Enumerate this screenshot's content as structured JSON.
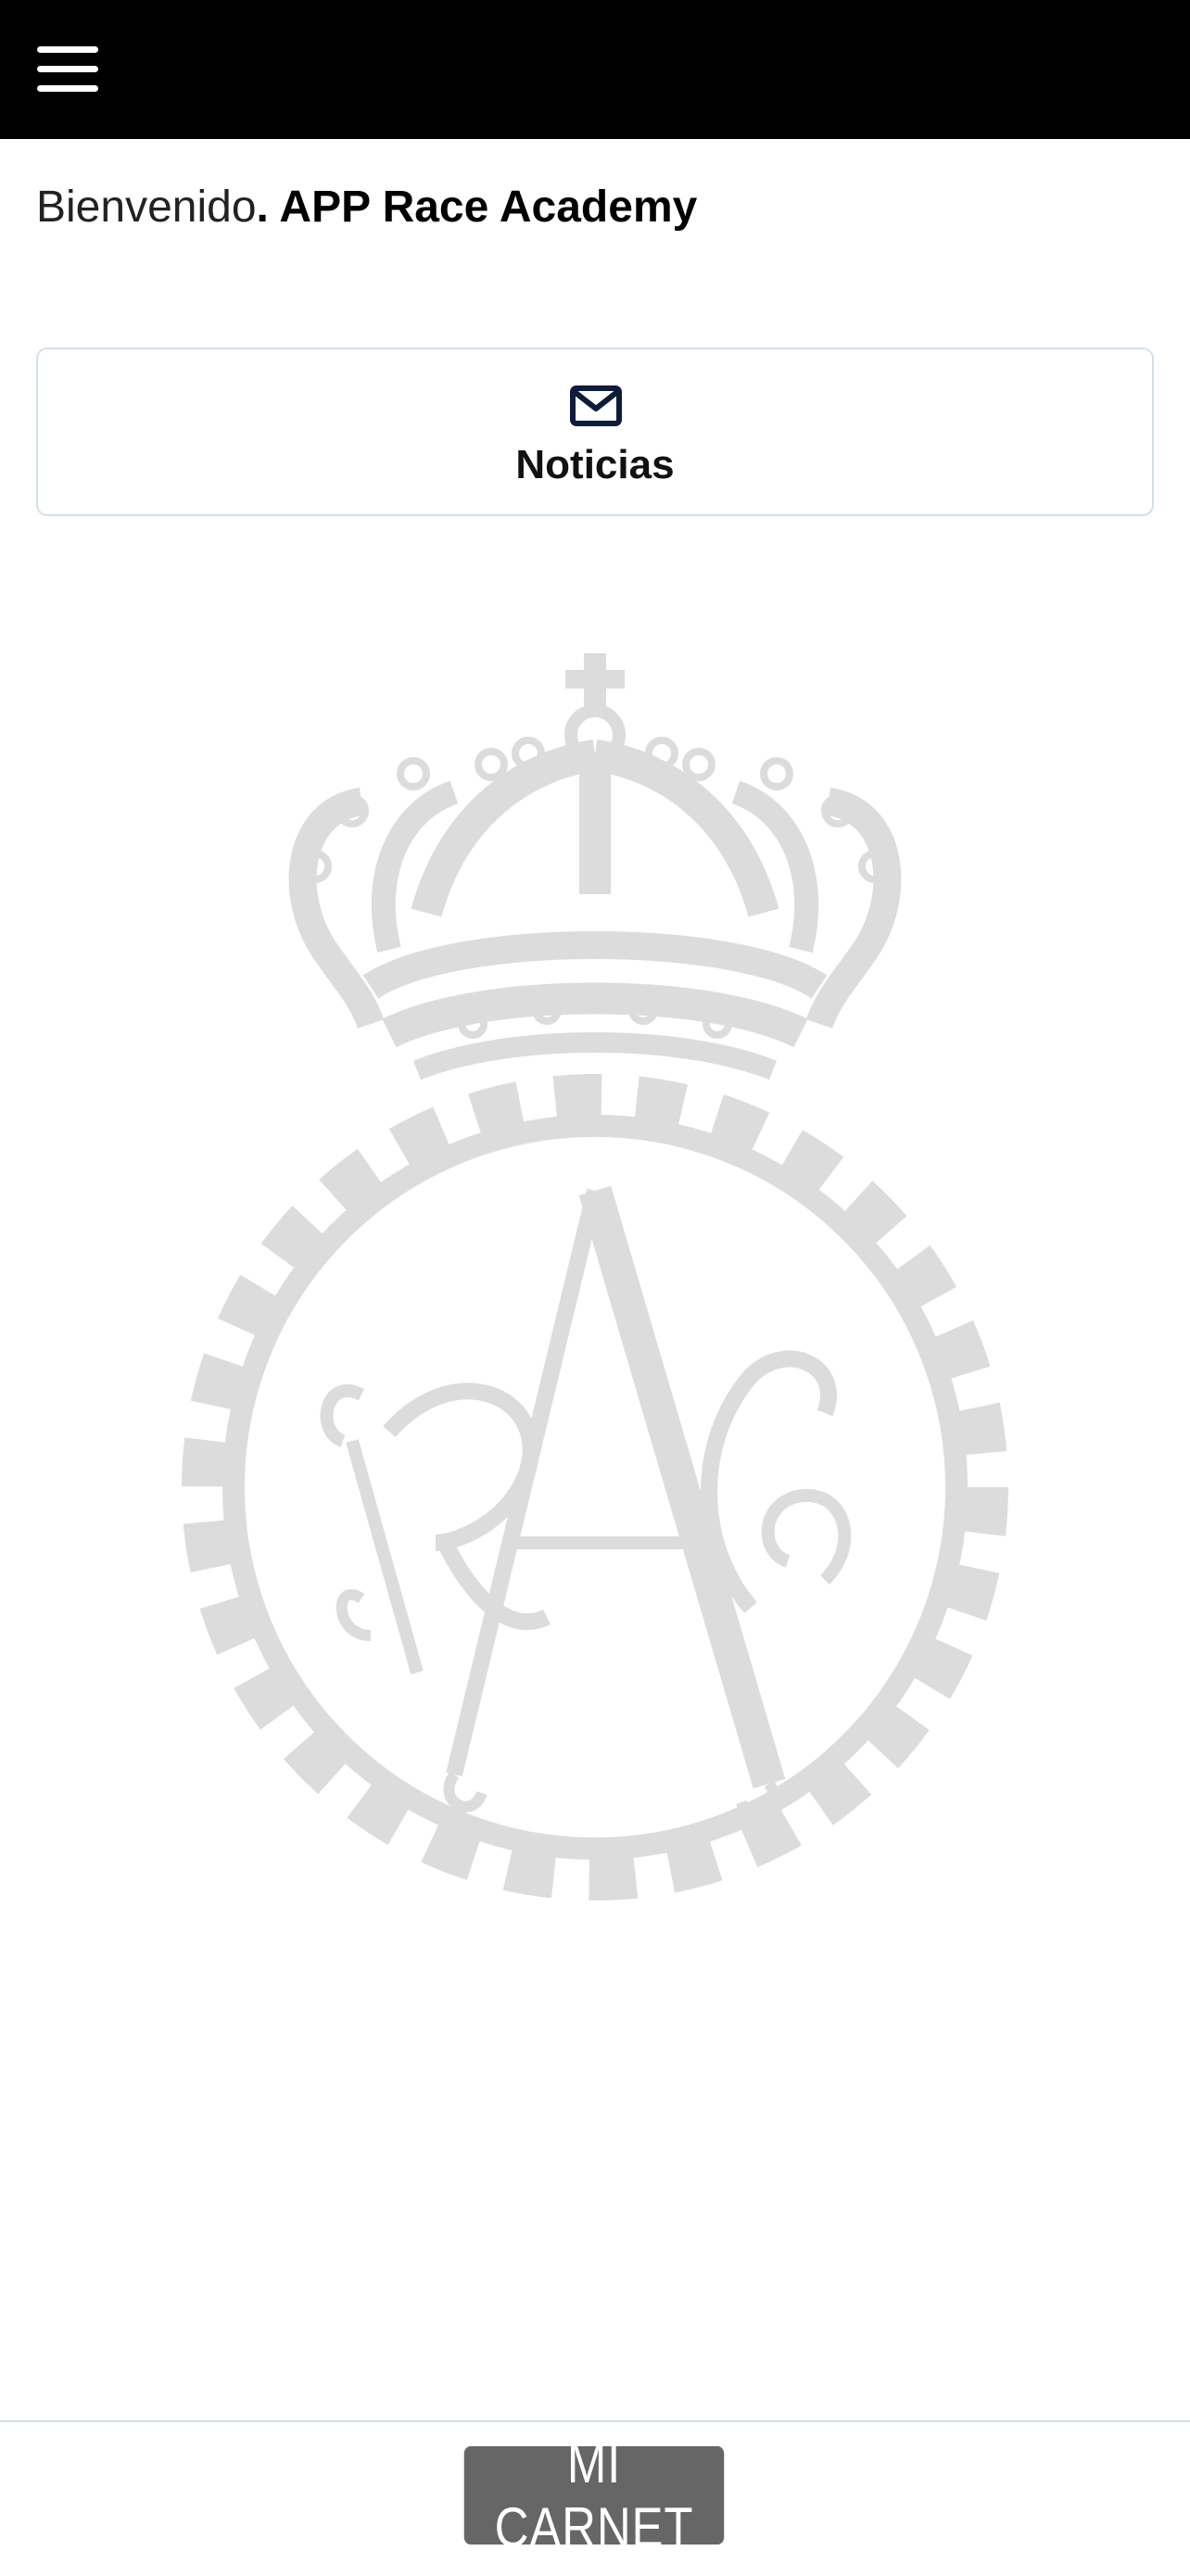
{
  "header": {
    "menu_icon": "hamburger-menu-icon",
    "background": "#000000"
  },
  "welcome": {
    "greeting": "Bienvenido",
    "name": ". APP Race Academy"
  },
  "news": {
    "icon": "mail-icon",
    "label": "Noticias"
  },
  "emblem": {
    "description_icon": "race-crown-emblem",
    "color": "#dcdcdc"
  },
  "footer": {
    "carnet_label": "MI CARNET",
    "button_color": "#666666"
  }
}
